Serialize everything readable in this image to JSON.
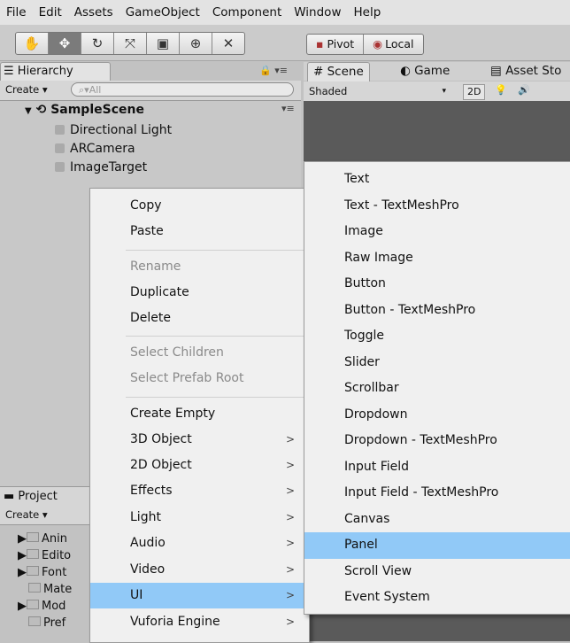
{
  "menubar": [
    "File",
    "Edit",
    "Assets",
    "GameObject",
    "Component",
    "Window",
    "Help"
  ],
  "toolbar": {
    "tools": [
      "hand-tool-icon",
      "move-tool-icon",
      "rotate-tool-icon",
      "scale-tool-icon",
      "rect-tool-icon",
      "transform-tool-icon",
      "custom-tool-icon"
    ],
    "pivot_label": "Pivot",
    "local_label": "Local"
  },
  "hierarchy": {
    "tab": "Hierarchy",
    "create": "Create",
    "search_placeholder": "All",
    "scene": "SampleScene",
    "items": [
      "Directional Light",
      "ARCamera",
      "ImageTarget"
    ]
  },
  "scene_tabs": {
    "scene": "Scene",
    "game": "Game",
    "asset_store": "Asset Sto",
    "shaded": "Shaded",
    "mode_2d": "2D"
  },
  "project": {
    "tab": "Project",
    "create": "Create",
    "folders": [
      "Anin",
      "Edito",
      "Font",
      "Mate",
      "Mod",
      "Pref"
    ]
  },
  "context_menu": [
    {
      "label": "Copy",
      "disabled": false,
      "submenu": false
    },
    {
      "label": "Paste",
      "disabled": false,
      "submenu": false
    },
    {
      "label": "Rename",
      "disabled": true,
      "submenu": false
    },
    {
      "label": "Duplicate",
      "disabled": false,
      "submenu": false
    },
    {
      "label": "Delete",
      "disabled": false,
      "submenu": false
    },
    {
      "label": "Select Children",
      "disabled": true,
      "submenu": false
    },
    {
      "label": "Select Prefab Root",
      "disabled": true,
      "submenu": false
    },
    {
      "label": "Create Empty",
      "disabled": false,
      "submenu": false
    },
    {
      "label": "3D Object",
      "disabled": false,
      "submenu": true
    },
    {
      "label": "2D Object",
      "disabled": false,
      "submenu": true
    },
    {
      "label": "Effects",
      "disabled": false,
      "submenu": true
    },
    {
      "label": "Light",
      "disabled": false,
      "submenu": true
    },
    {
      "label": "Audio",
      "disabled": false,
      "submenu": true
    },
    {
      "label": "Video",
      "disabled": false,
      "submenu": true
    },
    {
      "label": "UI",
      "disabled": false,
      "submenu": true,
      "highlighted": true
    },
    {
      "label": "Vuforia Engine",
      "disabled": false,
      "submenu": true
    }
  ],
  "ui_submenu": [
    {
      "label": "Text"
    },
    {
      "label": "Text - TextMeshPro"
    },
    {
      "label": "Image"
    },
    {
      "label": "Raw Image"
    },
    {
      "label": "Button"
    },
    {
      "label": "Button - TextMeshPro"
    },
    {
      "label": "Toggle"
    },
    {
      "label": "Slider"
    },
    {
      "label": "Scrollbar"
    },
    {
      "label": "Dropdown"
    },
    {
      "label": "Dropdown - TextMeshPro"
    },
    {
      "label": "Input Field"
    },
    {
      "label": "Input Field - TextMeshPro"
    },
    {
      "label": "Canvas"
    },
    {
      "label": "Panel",
      "highlighted": true
    },
    {
      "label": "Scroll View"
    },
    {
      "label": "Event System"
    }
  ],
  "colors": {
    "highlight": "#91c9f7",
    "menu_bg": "#f0f0f0",
    "scene_bg": "#5a5a5a"
  }
}
